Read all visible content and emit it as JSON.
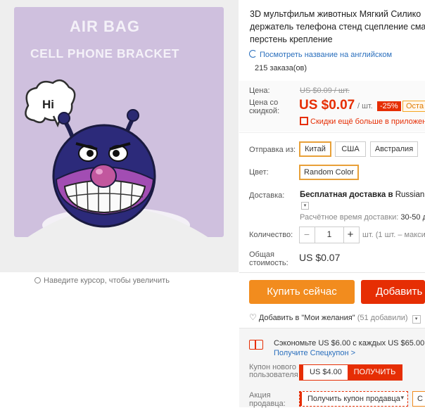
{
  "image": {
    "card_title_1": "AIR BAG",
    "card_title_2": "CELL PHONE BRACKET",
    "bubble_text": "Hi",
    "zoom_hint": "Наведите курсор, чтобы увеличить"
  },
  "product": {
    "title_lines": [
      "3D мультфильм животных Мягкий Силико",
      "держатель телефона стенд сцепление сма",
      "перстень крепление"
    ],
    "translate_link": "Посмотреть название на английском",
    "orders": "215 заказа(ов)"
  },
  "price": {
    "price_label": "Цена:",
    "old_price": "US $0.09 / шт.",
    "discount_label_1": "Цена со",
    "discount_label_2": "скидкой:",
    "current_price": "US $0.07",
    "unit": "/ шт.",
    "discount_badge": "-25%",
    "countdown_partial": "Оста",
    "app_discount": "Скидки ещё больше в приложени"
  },
  "options": {
    "ship_from_label": "Отправка из:",
    "ship_from": [
      "Китай",
      "США",
      "Австралия"
    ],
    "color_label": "Цвет:",
    "color_value": "Random Color"
  },
  "delivery": {
    "label": "Доставка:",
    "line1_prefix": "Бесплатная доставка в",
    "line1_dest": "Russian Fed",
    "estimate_label": "Расчётное время доставки:",
    "estimate_value": "30-50 дн"
  },
  "quantity": {
    "label": "Количество:",
    "minus": "−",
    "value": "1",
    "plus": "+",
    "note": "шт. (1 шт. – макси"
  },
  "total": {
    "label_1": "Общая",
    "label_2": "стоимость:",
    "value": "US $0.07"
  },
  "actions": {
    "buy_now": "Купить сейчас",
    "add_to_cart": "Добавить",
    "wishlist": "Добавить в \"Мои желания\"",
    "wishlist_count": "(51 добавили)"
  },
  "coupons": {
    "save_text": "Сэкономьте US $6.00 с каждых US $65.00",
    "get_coupon_link": "Получите Спецкупон >",
    "new_user_label_1": "Купон нового",
    "new_user_label_2": "пользователя",
    "new_user_amount": "US $4.00",
    "new_user_get": "ПОЛУЧИТЬ",
    "seller_label_1": "Акция",
    "seller_label_2": "продавца:",
    "seller_dropdown": "Получить купон продавца",
    "seller_partial": "С"
  },
  "colors": {
    "accent_orange": "#f28c1e",
    "price_red": "#e62e04",
    "link_blue": "#2a6fbd",
    "option_selected_border": "#e8a038"
  }
}
